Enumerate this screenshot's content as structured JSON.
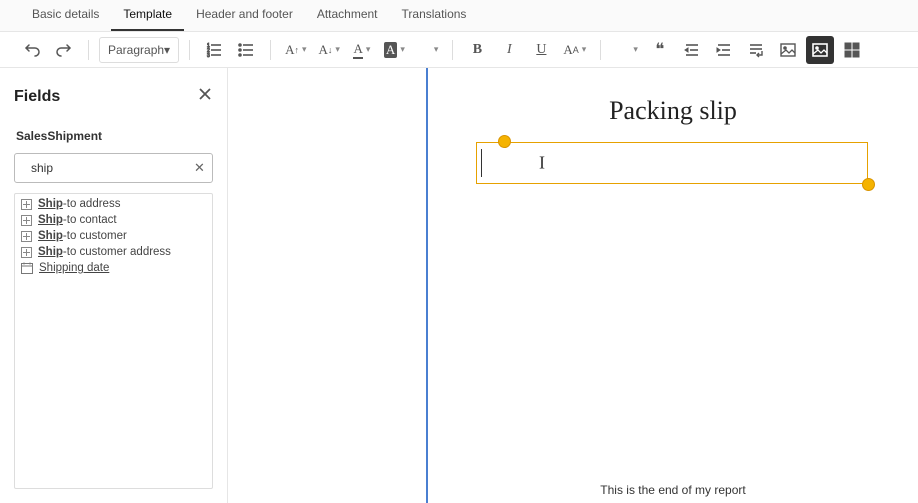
{
  "tabs": {
    "basic": "Basic details",
    "template": "Template",
    "headerfooter": "Header and footer",
    "attachment": "Attachment",
    "translations": "Translations"
  },
  "toolbar": {
    "paragraph": "Paragraph"
  },
  "fields": {
    "title": "Fields",
    "entity": "SalesShipment",
    "search_value": "ship",
    "search_placeholder": "Search",
    "items": [
      {
        "pre": "Ship",
        "rest": "-to address",
        "kind": "expand"
      },
      {
        "pre": "Ship",
        "rest": "-to contact",
        "kind": "expand"
      },
      {
        "pre": "Ship",
        "rest": "-to customer",
        "kind": "expand"
      },
      {
        "pre": "Ship",
        "rest": "-to customer address",
        "kind": "expand"
      },
      {
        "pre": "",
        "rest": "Shipping date",
        "kind": "date"
      }
    ]
  },
  "document": {
    "title": "Packing slip",
    "footer": "This is the end of my report"
  }
}
